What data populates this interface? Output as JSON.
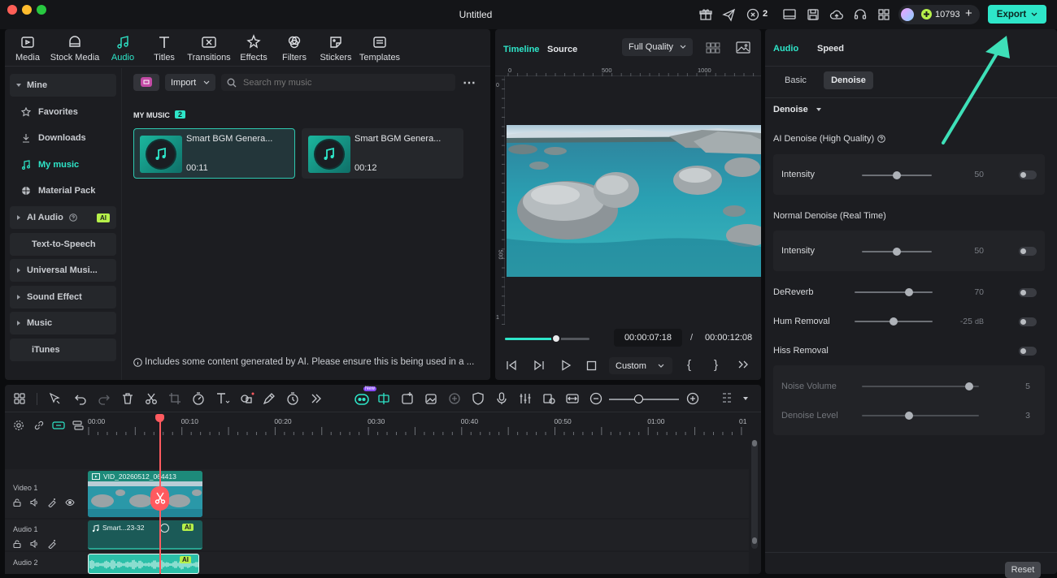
{
  "window": {
    "title": "Untitled"
  },
  "header": {
    "notifications_count": "2",
    "coins": "10793",
    "export_label": "Export"
  },
  "media_tabs": [
    {
      "label": "Media",
      "icon": "media-icon"
    },
    {
      "label": "Stock Media",
      "icon": "stock-media-icon"
    },
    {
      "label": "Audio",
      "icon": "audio-icon"
    },
    {
      "label": "Titles",
      "icon": "titles-icon"
    },
    {
      "label": "Transitions",
      "icon": "transitions-icon"
    },
    {
      "label": "Effects",
      "icon": "effects-icon"
    },
    {
      "label": "Filters",
      "icon": "filters-icon"
    },
    {
      "label": "Stickers",
      "icon": "stickers-icon"
    },
    {
      "label": "Templates",
      "icon": "templates-icon"
    }
  ],
  "sidebar": {
    "items": [
      {
        "label": "Mine"
      },
      {
        "label": "Favorites"
      },
      {
        "label": "Downloads"
      },
      {
        "label": "My music"
      },
      {
        "label": "Material Pack"
      },
      {
        "label": "AI Audio",
        "badge": "AI"
      },
      {
        "label": "Text-to-Speech"
      },
      {
        "label": "Universal Musi..."
      },
      {
        "label": "Sound Effect"
      },
      {
        "label": "Music"
      },
      {
        "label": "iTunes"
      }
    ]
  },
  "library": {
    "import_label": "Import",
    "search_placeholder": "Search my music",
    "section_title": "MY MUSIC",
    "section_count": "2",
    "cards": [
      {
        "name": "Smart BGM Genera...",
        "duration": "00:11"
      },
      {
        "name": "Smart BGM Genera...",
        "duration": "00:12"
      }
    ],
    "footer_note": "Includes some content generated by AI. Please ensure this is being used in a ..."
  },
  "preview": {
    "tabs": [
      "Timeline",
      "Source"
    ],
    "quality": "Full Quality",
    "ruler_top": [
      "0",
      "500",
      "1000"
    ],
    "ruler_left": [
      "0",
      "500",
      "1"
    ],
    "current_time": "00:00:07:18",
    "separator": "/",
    "total_time": "00:00:12:08",
    "zoom_option": "Custom",
    "progress": 0.61
  },
  "properties": {
    "tabs": [
      "Audio",
      "Speed"
    ],
    "subtabs": [
      "Basic",
      "Denoise"
    ],
    "section_title": "Denoise",
    "ai_denoise_label": "AI Denoise (High Quality)",
    "ai_intensity": {
      "label": "Intensity",
      "value": "50",
      "level": 0.5
    },
    "normal_denoise_label": "Normal Denoise (Real Time)",
    "normal_intensity": {
      "label": "Intensity",
      "value": "50",
      "level": 0.5
    },
    "dereverb": {
      "label": "DeReverb",
      "value": "70",
      "level": 0.7
    },
    "hum_removal": {
      "label": "Hum Removal",
      "value": "-25",
      "unit": "dB",
      "level": 0.5
    },
    "hiss_removal": {
      "label": "Hiss Removal"
    },
    "noise_volume": {
      "label": "Noise Volume",
      "value": "5",
      "level": 0.92
    },
    "denoise_level": {
      "label": "Denoise Level",
      "value": "3",
      "level": 0.4
    },
    "reset_label": "Reset"
  },
  "timeline": {
    "ticks": [
      "00:00",
      "00:10",
      "00:20",
      "00:30",
      "00:40",
      "00:50",
      "01:00",
      "01"
    ],
    "tracks": [
      {
        "label": "Video 1"
      },
      {
        "label": "Audio 1"
      },
      {
        "label": "Audio 2"
      }
    ],
    "video_clip_name": "VID_20260512_064413",
    "audio_clip_name": "Smart...23-32",
    "ai_badge": "AI",
    "new_badge": "New"
  },
  "colors": {
    "accent": "#2ee6c9",
    "panel": "#1c1d21",
    "playhead": "#ff5a5f",
    "ai_badge": "#b6f04a"
  }
}
